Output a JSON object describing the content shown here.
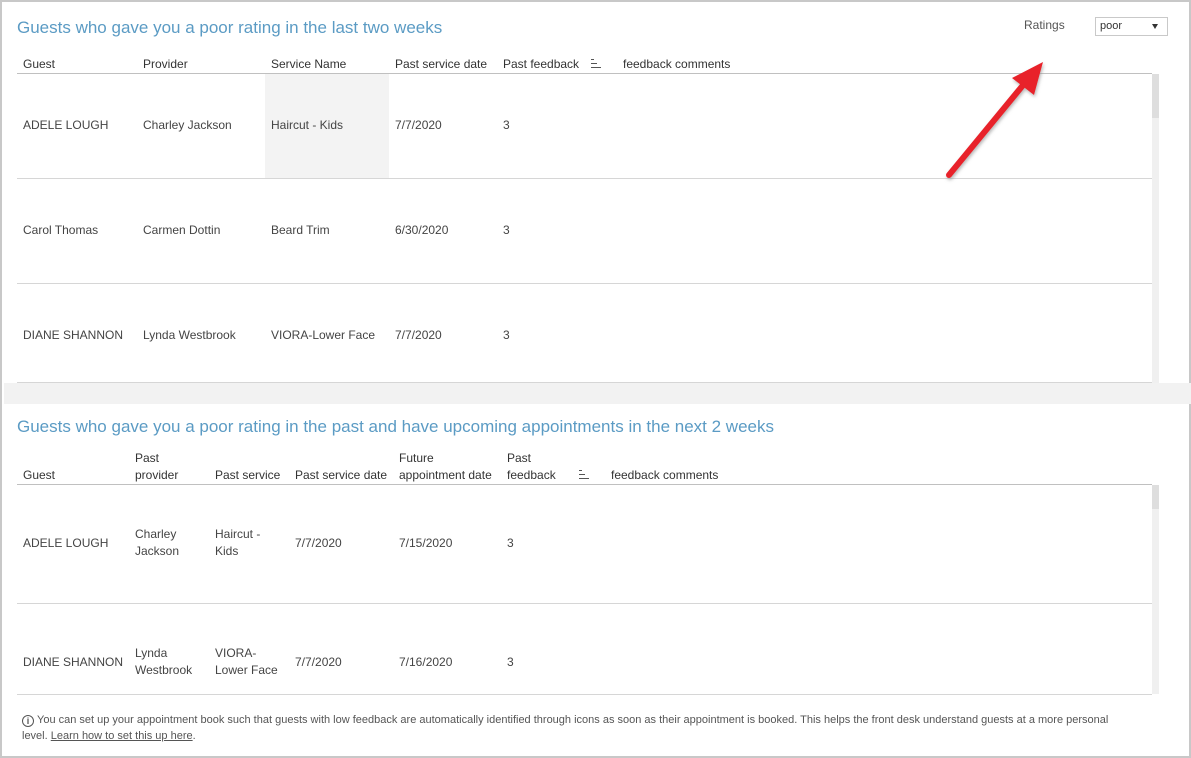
{
  "section1": {
    "title": "Guests who gave you a poor rating in the last two weeks",
    "filter_label": "Ratings",
    "filter_value": "poor",
    "headers": {
      "guest": "Guest",
      "provider": "Provider",
      "service": "Service Name",
      "past_date": "Past service date",
      "past_feedback": "Past feedback",
      "comments": "feedback comments"
    },
    "rows": [
      {
        "guest": "ADELE LOUGH",
        "provider": "Charley Jackson",
        "service": "Haircut - Kids",
        "past_date": "7/7/2020",
        "feedback": "3"
      },
      {
        "guest": "Carol Thomas",
        "provider": "Carmen Dottin",
        "service": "Beard Trim",
        "past_date": "6/30/2020",
        "feedback": "3"
      },
      {
        "guest": "DIANE SHANNON",
        "provider": "Lynda Westbrook",
        "service": "VIORA-Lower Face",
        "past_date": "7/7/2020",
        "feedback": "3"
      }
    ]
  },
  "section2": {
    "title": "Guests who gave you a poor rating in the past and have upcoming appointments in the next 2 weeks",
    "headers": {
      "guest": "Guest",
      "past_provider_1": "Past",
      "past_provider_2": "provider",
      "past_service": "Past service",
      "past_date": "Past service date",
      "future_1": "Future",
      "future_2": "appointment date",
      "feedback_1": "Past",
      "feedback_2": "feedback",
      "comments": "feedback comments"
    },
    "rows": [
      {
        "guest": "ADELE LOUGH",
        "provider_1": "Charley",
        "provider_2": "Jackson",
        "service_1": "Haircut -",
        "service_2": "Kids",
        "past_date": "7/7/2020",
        "future_date": "7/15/2020",
        "feedback": "3"
      },
      {
        "guest": "DIANE SHANNON",
        "provider_1": "Lynda",
        "provider_2": "Westbrook",
        "service_1": "VIORA-",
        "service_2": "Lower Face",
        "past_date": "7/7/2020",
        "future_date": "7/16/2020",
        "feedback": "3"
      }
    ]
  },
  "footer": {
    "info_icon": "i",
    "text": "You can set up your appointment book such that guests with low feedback are automatically identified through icons as soon as their appointment is booked. This helps the front desk understand guests at a more personal level.",
    "link": "Learn how to set this up here"
  },
  "colors": {
    "title": "#5b9bc4",
    "arrow": "#e8202a",
    "highlight": "#f3f3f3"
  }
}
